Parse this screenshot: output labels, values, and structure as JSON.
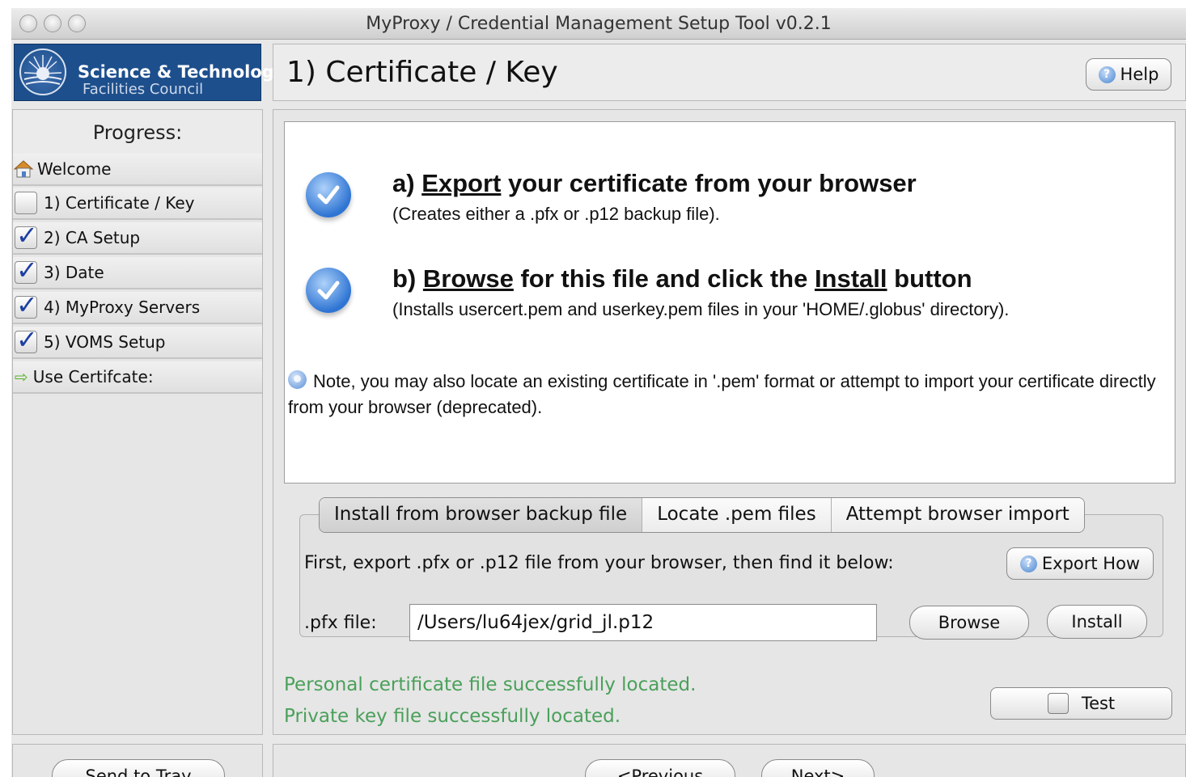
{
  "window": {
    "title": "MyProxy / Credential Management Setup Tool v0.2.1"
  },
  "logo": {
    "line1": "Science & Technology",
    "line2": "Facilities Council"
  },
  "header": {
    "title": "1) Certificate / Key",
    "help_label": "Help"
  },
  "sidebar": {
    "heading": "Progress:",
    "items": [
      {
        "label": "Welcome",
        "icon": "home-icon",
        "checked": null
      },
      {
        "label": "1) Certificate / Key",
        "icon": "checkbox",
        "checked": false
      },
      {
        "label": "2) CA Setup",
        "icon": "checkbox",
        "checked": true
      },
      {
        "label": "3) Date",
        "icon": "checkbox",
        "checked": true
      },
      {
        "label": "4) MyProxy Servers",
        "icon": "checkbox",
        "checked": true
      },
      {
        "label": "5) VOMS Setup",
        "icon": "checkbox",
        "checked": true
      },
      {
        "label": "Use Certifcate:",
        "icon": "arrow-right-icon",
        "checked": null
      }
    ]
  },
  "instructions": {
    "step_a": {
      "prefix": "a) ",
      "link": "Export",
      "rest": " your certificate from your browser",
      "desc": "(Creates either a .pfx or .p12 backup file)."
    },
    "step_b": {
      "prefix": "b) ",
      "link": "Browse",
      "middle": " for this file and click the ",
      "link2": "Install",
      "rest": " button",
      "desc": "(Installs usercert.pem and userkey.pem files in your 'HOME/.globus' directory)."
    },
    "note": "Note, you may also locate an existing certificate in '.pem' format or attempt to import your certificate directly from your browser (deprecated)."
  },
  "tabs": [
    {
      "label": "Install from browser backup file",
      "active": true
    },
    {
      "label": "Locate .pem files",
      "active": false
    },
    {
      "label": "Attempt browser import",
      "active": false
    }
  ],
  "install_panel": {
    "prompt": "First, export .pfx or .p12 file from your browser, then find it below:",
    "export_how_label": "Export How",
    "file_label": ".pfx file:",
    "file_value": "/Users/lu64jex/grid_jl.p12",
    "browse_label": "Browse",
    "install_label": "Install"
  },
  "status": {
    "line1": "Personal certificate file successfully located.",
    "line2": "Private key file successfully located."
  },
  "test_label": "Test",
  "footer": {
    "send_to_tray": "Send to Tray",
    "previous": "<Previous",
    "next": "Next>"
  },
  "colors": {
    "status_green": "#4aa05a",
    "logo_blue": "#1d4f8c",
    "check_blue": "#1c3fa3"
  }
}
